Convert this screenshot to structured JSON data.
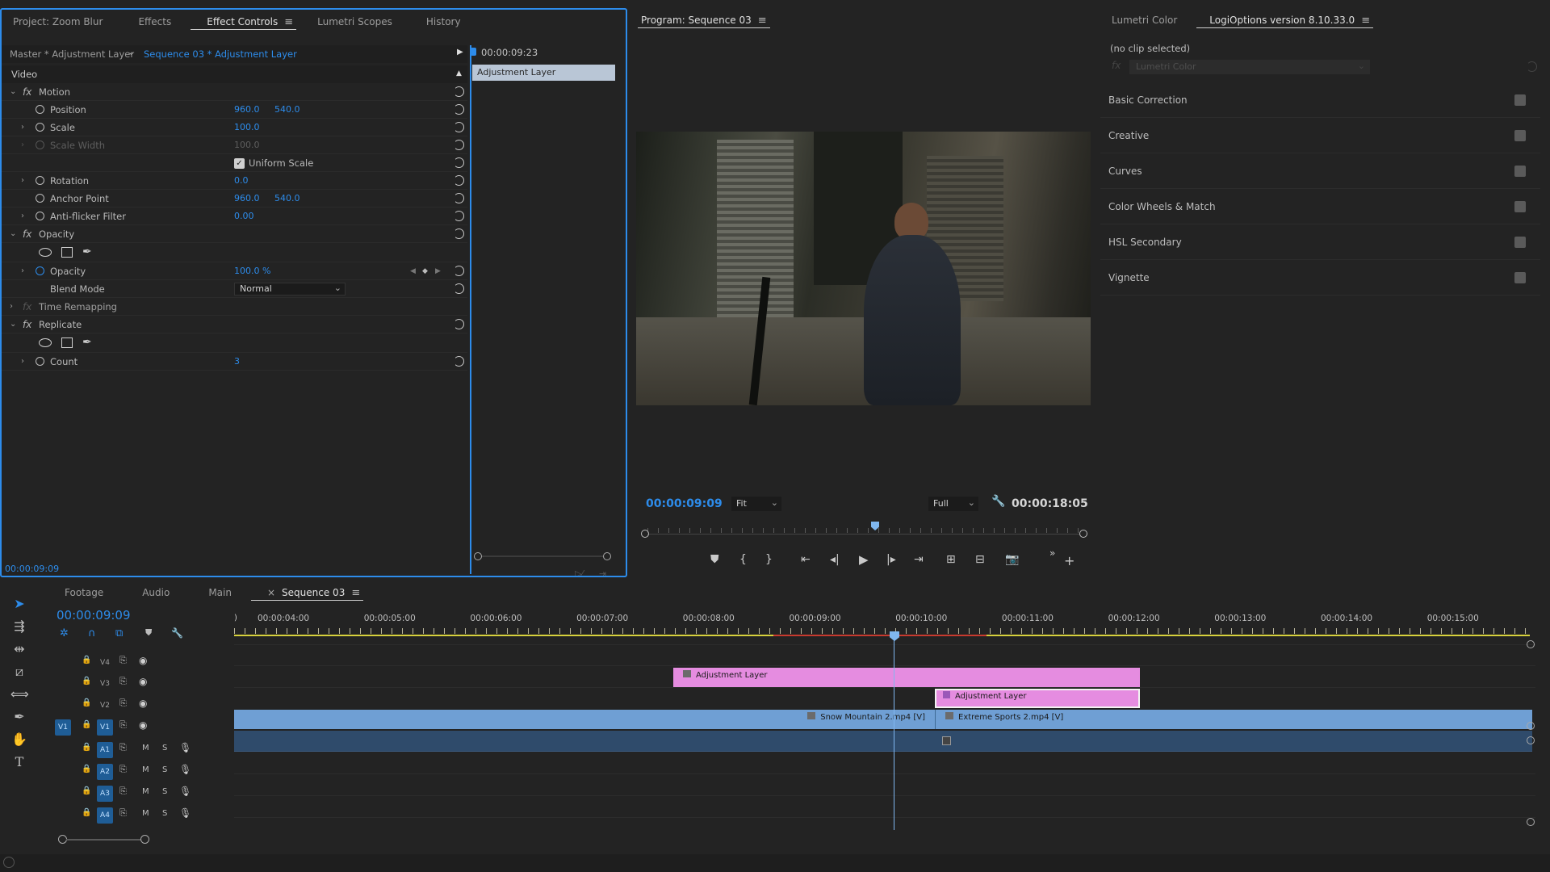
{
  "left_panel": {
    "tabs": [
      {
        "label": "Project: Zoom Blur"
      },
      {
        "label": "Effects"
      },
      {
        "label": "Effect Controls",
        "active": true
      },
      {
        "label": "Lumetri Scopes"
      },
      {
        "label": "History"
      }
    ],
    "source_master": "Master * Adjustment Layer",
    "source_sequence": "Sequence 03 * Adjustment Layer",
    "ruler_time": "00:00:09:23",
    "clip_label": "Adjustment Layer",
    "section_video": "Video",
    "footer_time": "00:00:09:09",
    "motion": {
      "label": "Motion",
      "position_label": "Position",
      "position_x": "960.0",
      "position_y": "540.0",
      "scale_label": "Scale",
      "scale_value": "100.0",
      "scale_width_label": "Scale Width",
      "scale_width_value": "100.0",
      "uniform_scale_label": "Uniform Scale",
      "rotation_label": "Rotation",
      "rotation_value": "0.0",
      "anchor_label": "Anchor Point",
      "anchor_x": "960.0",
      "anchor_y": "540.0",
      "antiflicker_label": "Anti-flicker Filter",
      "antiflicker_value": "0.00"
    },
    "opacity": {
      "label": "Opacity",
      "opacity_label": "Opacity",
      "opacity_value": "100.0 %",
      "blend_label": "Blend Mode",
      "blend_value": "Normal"
    },
    "time_remap_label": "Time Remapping",
    "replicate": {
      "label": "Replicate",
      "count_label": "Count",
      "count_value": "3"
    }
  },
  "program": {
    "title": "Program: Sequence 03",
    "current_time": "00:00:09:09",
    "fit_value": "Fit",
    "quality_value": "Full",
    "duration": "00:00:18:05"
  },
  "lumetri": {
    "tabs": [
      {
        "label": "Lumetri Color"
      },
      {
        "label": "LogiOptions version 8.10.33.0",
        "active": true
      }
    ],
    "no_clip": "(no clip selected)",
    "fx_select": "Lumetri Color",
    "sections": [
      "Basic Correction",
      "Creative",
      "Curves",
      "Color Wheels & Match",
      "HSL Secondary",
      "Vignette"
    ]
  },
  "timeline": {
    "tabs": [
      {
        "label": "Footage"
      },
      {
        "label": "Audio"
      },
      {
        "label": "Main"
      },
      {
        "label": "Sequence 03",
        "active": true
      }
    ],
    "timecode": "00:00:09:09",
    "ruler_labels": [
      "00:00:04:00",
      "00:00:05:00",
      "00:00:06:00",
      "00:00:07:00",
      "00:00:08:00",
      "00:00:09:00",
      "00:00:10:00",
      "00:00:11:00",
      "00:00:12:00",
      "00:00:13:00",
      "00:00:14:00",
      "00:00:15:00"
    ],
    "video_tracks": [
      "V4",
      "V3",
      "V2",
      "V1"
    ],
    "audio_tracks": [
      "A1",
      "A2",
      "A3",
      "A4"
    ],
    "source_patch": "V1",
    "mute_label": "M",
    "solo_label": "S",
    "clips": {
      "v3_adjustment": "Adjustment Layer",
      "v2_adjustment": "Adjustment Layer",
      "v1_a": "Snow Mountain 2.mp4 [V]",
      "v1_b": "Extreme Sports 2.mp4 [V]"
    }
  },
  "colors": {
    "accent_blue": "#2d8ceb",
    "adjustment_clip": "#e58ce0",
    "video_clip": "#6f9fd4",
    "audio_track": "#2f4b6b",
    "playhead": "#7fb7ef"
  }
}
